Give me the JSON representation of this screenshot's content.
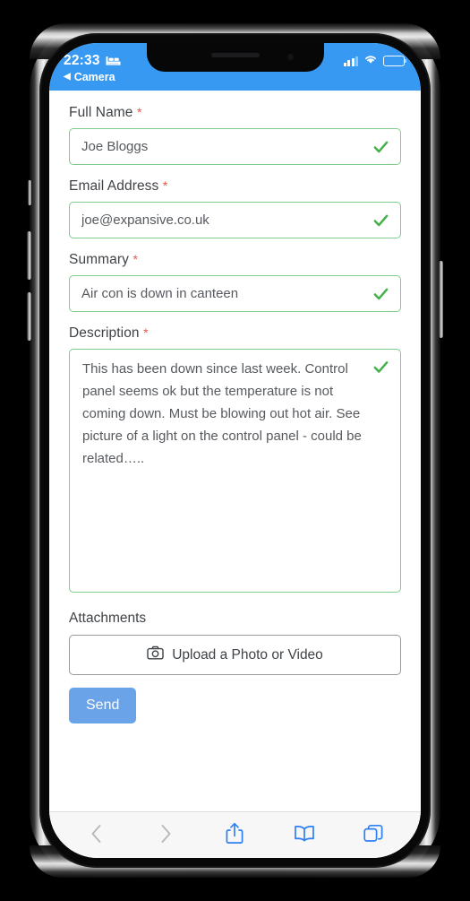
{
  "status_bar": {
    "time": "22:33",
    "bed_icon": "bed-icon",
    "signal_icon": "signal-bars-icon",
    "signal_bars_filled": 3,
    "signal_bars_total": 4,
    "wifi_icon": "wifi-icon",
    "battery_icon": "battery-icon",
    "battery_level_percent": 32
  },
  "nav": {
    "back_caret": "◀",
    "back_label": "Camera"
  },
  "form": {
    "fields": [
      {
        "label": "Full Name",
        "required_mark": "*",
        "value": "Joe Bloggs",
        "valid_icon": "check-icon"
      },
      {
        "label": "Email Address",
        "required_mark": "*",
        "value": "joe@expansive.co.uk",
        "valid_icon": "check-icon"
      },
      {
        "label": "Summary",
        "required_mark": "*",
        "value": "Air con is down in canteen",
        "valid_icon": "check-icon"
      }
    ],
    "description": {
      "label": "Description",
      "required_mark": "*",
      "value": "This has been down since last week. Control panel seems ok but the temperature is not coming down. Must be blowing out hot air. See picture of a light on the control panel - could be related…..",
      "valid_icon": "check-icon"
    },
    "attachments": {
      "label": "Attachments",
      "upload_icon": "camera-icon",
      "upload_label": "Upload a Photo or Video"
    },
    "submit_label": "Send"
  },
  "toolbar": {
    "back_icon": "chevron-left-icon",
    "forward_icon": "chevron-right-icon",
    "share_icon": "share-icon",
    "bookmarks_icon": "book-icon",
    "tabs_icon": "tabs-icon"
  },
  "colors": {
    "header_blue": "#3899F2",
    "valid_green": "#43B04A",
    "border_green": "#7FCB8C",
    "required_red": "#E8574A",
    "send_blue": "#6AA3E8",
    "toolbar_blue": "#2F7FF5"
  }
}
